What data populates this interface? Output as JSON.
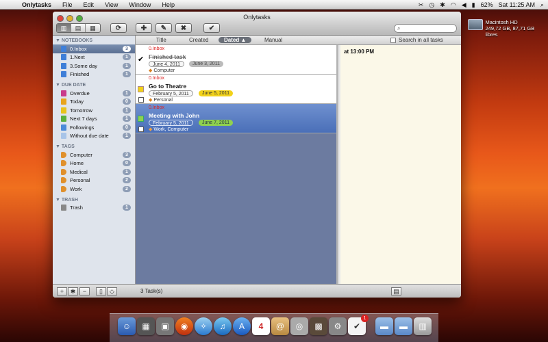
{
  "menubar": {
    "app_name": "Onlytasks",
    "menus": [
      "File",
      "Edit",
      "View",
      "Window",
      "Help"
    ],
    "battery": "62%",
    "clock": "Sat 11:25 AM"
  },
  "desktop": {
    "disk_name": "Macintosh HD",
    "disk_info": "249,72 GB, 87,71 GB libres"
  },
  "window": {
    "title": "Onlytasks",
    "search_placeholder": ""
  },
  "sidebar": {
    "notebooks_header": "NOTEBOOKS",
    "notebooks": [
      {
        "label": "0.Inbox",
        "count": "3"
      },
      {
        "label": "1.Next",
        "count": "1"
      },
      {
        "label": "3.Some day",
        "count": "1"
      },
      {
        "label": "Finished",
        "count": "1"
      }
    ],
    "due_header": "DUE DATE",
    "due": [
      {
        "label": "Overdue",
        "count": "1"
      },
      {
        "label": "Today",
        "count": "0"
      },
      {
        "label": "Tomorrow",
        "count": "1"
      },
      {
        "label": "Next 7 days",
        "count": "1"
      },
      {
        "label": "Followings",
        "count": "0"
      },
      {
        "label": "Without due date",
        "count": "1"
      }
    ],
    "tags_header": "TAGS",
    "tags": [
      {
        "label": "Computer",
        "count": "3"
      },
      {
        "label": "Home",
        "count": "0"
      },
      {
        "label": "Medical",
        "count": "1"
      },
      {
        "label": "Personal",
        "count": "2"
      },
      {
        "label": "Work",
        "count": "2"
      }
    ],
    "trash_header": "TRASH",
    "trash": [
      {
        "label": "Trash",
        "count": "1"
      }
    ]
  },
  "list_header": {
    "title": "Title",
    "created": "Created",
    "dated": "Dated",
    "manual": "Manual",
    "search_all": "Search in all tasks"
  },
  "tasks": [
    {
      "notebook": "0.Inbox",
      "title": "Finished task",
      "start": "June 4, 2011",
      "due": "June 3, 2011",
      "tags": "Computer"
    },
    {
      "notebook": "0.Inbox",
      "title": "Go to Theatre",
      "start": "February 5, 2011",
      "due": "June 5, 2011",
      "tags": "Personal"
    },
    {
      "notebook": "0.Inbox",
      "title": "Meeting with John",
      "start": "February 5, 2011",
      "due": "June 7, 2011",
      "tags": "Work, Computer"
    }
  ],
  "detail": {
    "text": "at 13:00 PM"
  },
  "footer": {
    "task_count": "3  Task(s)"
  },
  "colors": {
    "selected_task": "#4a6fb8",
    "due_yellow": "#f2d21a",
    "due_green": "#8fd14f",
    "notebook_red": "#dd2222"
  },
  "dock": {
    "calendar_day": "4",
    "badge": "1"
  }
}
